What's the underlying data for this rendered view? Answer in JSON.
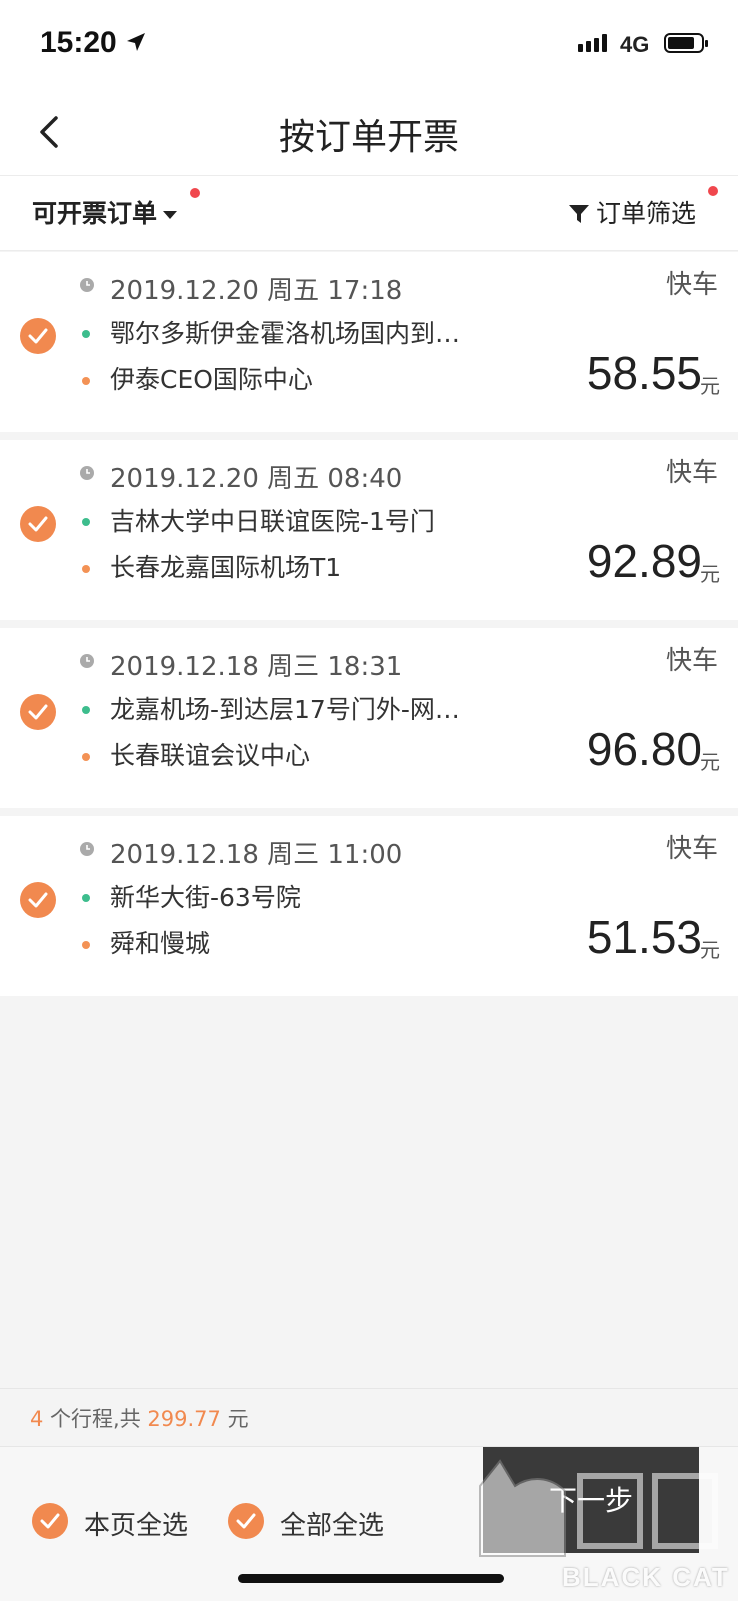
{
  "status_bar": {
    "time": "15:20",
    "network": "4G"
  },
  "nav": {
    "title": "按订单开票"
  },
  "filter": {
    "left_label": "可开票订单",
    "right_label": "订单筛选"
  },
  "orders": [
    {
      "datetime": "2019.12.20  周五  17:18",
      "type": "快车",
      "from": "鄂尔多斯伊金霍洛机场国内到…",
      "to": "伊泰CEO国际中心",
      "price": "58.55",
      "currency": "元",
      "selected": true
    },
    {
      "datetime": "2019.12.20  周五  08:40",
      "type": "快车",
      "from": "吉林大学中日联谊医院-1号门",
      "to": "长春龙嘉国际机场T1",
      "price": "92.89",
      "currency": "元",
      "selected": true
    },
    {
      "datetime": "2019.12.18  周三  18:31",
      "type": "快车",
      "from": "龙嘉机场-到达层17号门外-网…",
      "to": "长春联谊会议中心",
      "price": "96.80",
      "currency": "元",
      "selected": true
    },
    {
      "datetime": "2019.12.18  周三  11:00",
      "type": "快车",
      "from": "新华大街-63号院",
      "to": "舜和慢城",
      "price": "51.53",
      "currency": "元",
      "selected": true
    }
  ],
  "summary": {
    "count": "4",
    "count_suffix": " 个行程,共 ",
    "total": "299.77",
    "unit": " 元"
  },
  "bottom": {
    "select_page_label": "本页全选",
    "select_all_label": "全部全选",
    "next_label": "下一步"
  },
  "watermark": {
    "text": "BLACK CAT"
  },
  "colors": {
    "accent": "#f1894f",
    "start_dot": "#3dbd8d",
    "end_dot": "#f39255",
    "notify_dot": "#f0474d"
  }
}
